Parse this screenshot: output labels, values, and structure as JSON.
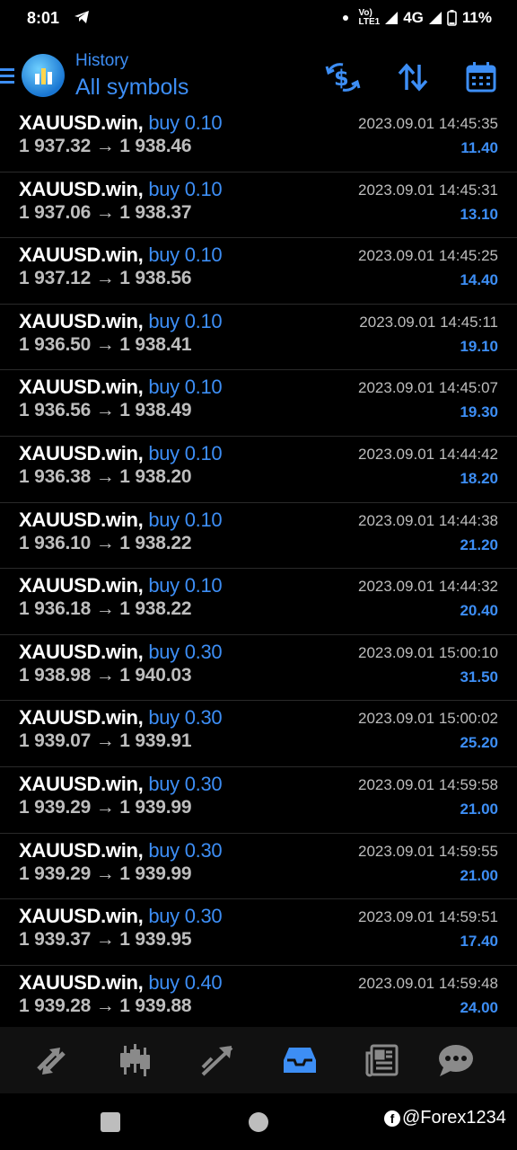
{
  "status_bar": {
    "time": "8:01",
    "network": "4G",
    "battery": "11%"
  },
  "header": {
    "subtitle": "History",
    "title": "All symbols",
    "accent_color": "#3d8ef5"
  },
  "trades": [
    {
      "symbol": "XAUUSD.win,",
      "side": "buy 0.10",
      "prices": "1 937.32 → 1 938.46",
      "time": "2023.09.01 14:45:35",
      "profit": "11.40"
    },
    {
      "symbol": "XAUUSD.win,",
      "side": "buy 0.10",
      "prices": "1 937.06 → 1 938.37",
      "time": "2023.09.01 14:45:31",
      "profit": "13.10"
    },
    {
      "symbol": "XAUUSD.win,",
      "side": "buy 0.10",
      "prices": "1 937.12 → 1 938.56",
      "time": "2023.09.01 14:45:25",
      "profit": "14.40"
    },
    {
      "symbol": "XAUUSD.win,",
      "side": "buy 0.10",
      "prices": "1 936.50 → 1 938.41",
      "time": "2023.09.01 14:45:11",
      "profit": "19.10"
    },
    {
      "symbol": "XAUUSD.win,",
      "side": "buy 0.10",
      "prices": "1 936.56 → 1 938.49",
      "time": "2023.09.01 14:45:07",
      "profit": "19.30"
    },
    {
      "symbol": "XAUUSD.win,",
      "side": "buy 0.10",
      "prices": "1 936.38 → 1 938.20",
      "time": "2023.09.01 14:44:42",
      "profit": "18.20"
    },
    {
      "symbol": "XAUUSD.win,",
      "side": "buy 0.10",
      "prices": "1 936.10 → 1 938.22",
      "time": "2023.09.01 14:44:38",
      "profit": "21.20"
    },
    {
      "symbol": "XAUUSD.win,",
      "side": "buy 0.10",
      "prices": "1 936.18 → 1 938.22",
      "time": "2023.09.01 14:44:32",
      "profit": "20.40"
    },
    {
      "symbol": "XAUUSD.win,",
      "side": "buy 0.30",
      "prices": "1 938.98 → 1 940.03",
      "time": "2023.09.01 15:00:10",
      "profit": "31.50"
    },
    {
      "symbol": "XAUUSD.win,",
      "side": "buy 0.30",
      "prices": "1 939.07 → 1 939.91",
      "time": "2023.09.01 15:00:02",
      "profit": "25.20"
    },
    {
      "symbol": "XAUUSD.win,",
      "side": "buy 0.30",
      "prices": "1 939.29 → 1 939.99",
      "time": "2023.09.01 14:59:58",
      "profit": "21.00"
    },
    {
      "symbol": "XAUUSD.win,",
      "side": "buy 0.30",
      "prices": "1 939.29 → 1 939.99",
      "time": "2023.09.01 14:59:55",
      "profit": "21.00"
    },
    {
      "symbol": "XAUUSD.win,",
      "side": "buy 0.30",
      "prices": "1 939.37 → 1 939.95",
      "time": "2023.09.01 14:59:51",
      "profit": "17.40"
    },
    {
      "symbol": "XAUUSD.win,",
      "side": "buy 0.40",
      "prices": "1 939.28 → 1 939.88",
      "time": "2023.09.01 14:59:48",
      "profit": "24.00"
    }
  ],
  "bottom_nav": {
    "items": [
      "quotes-icon",
      "chart-icon",
      "trade-icon",
      "history-icon",
      "news-icon",
      "messages-icon"
    ],
    "active": "history-icon"
  },
  "watermark": "@Forex1234"
}
